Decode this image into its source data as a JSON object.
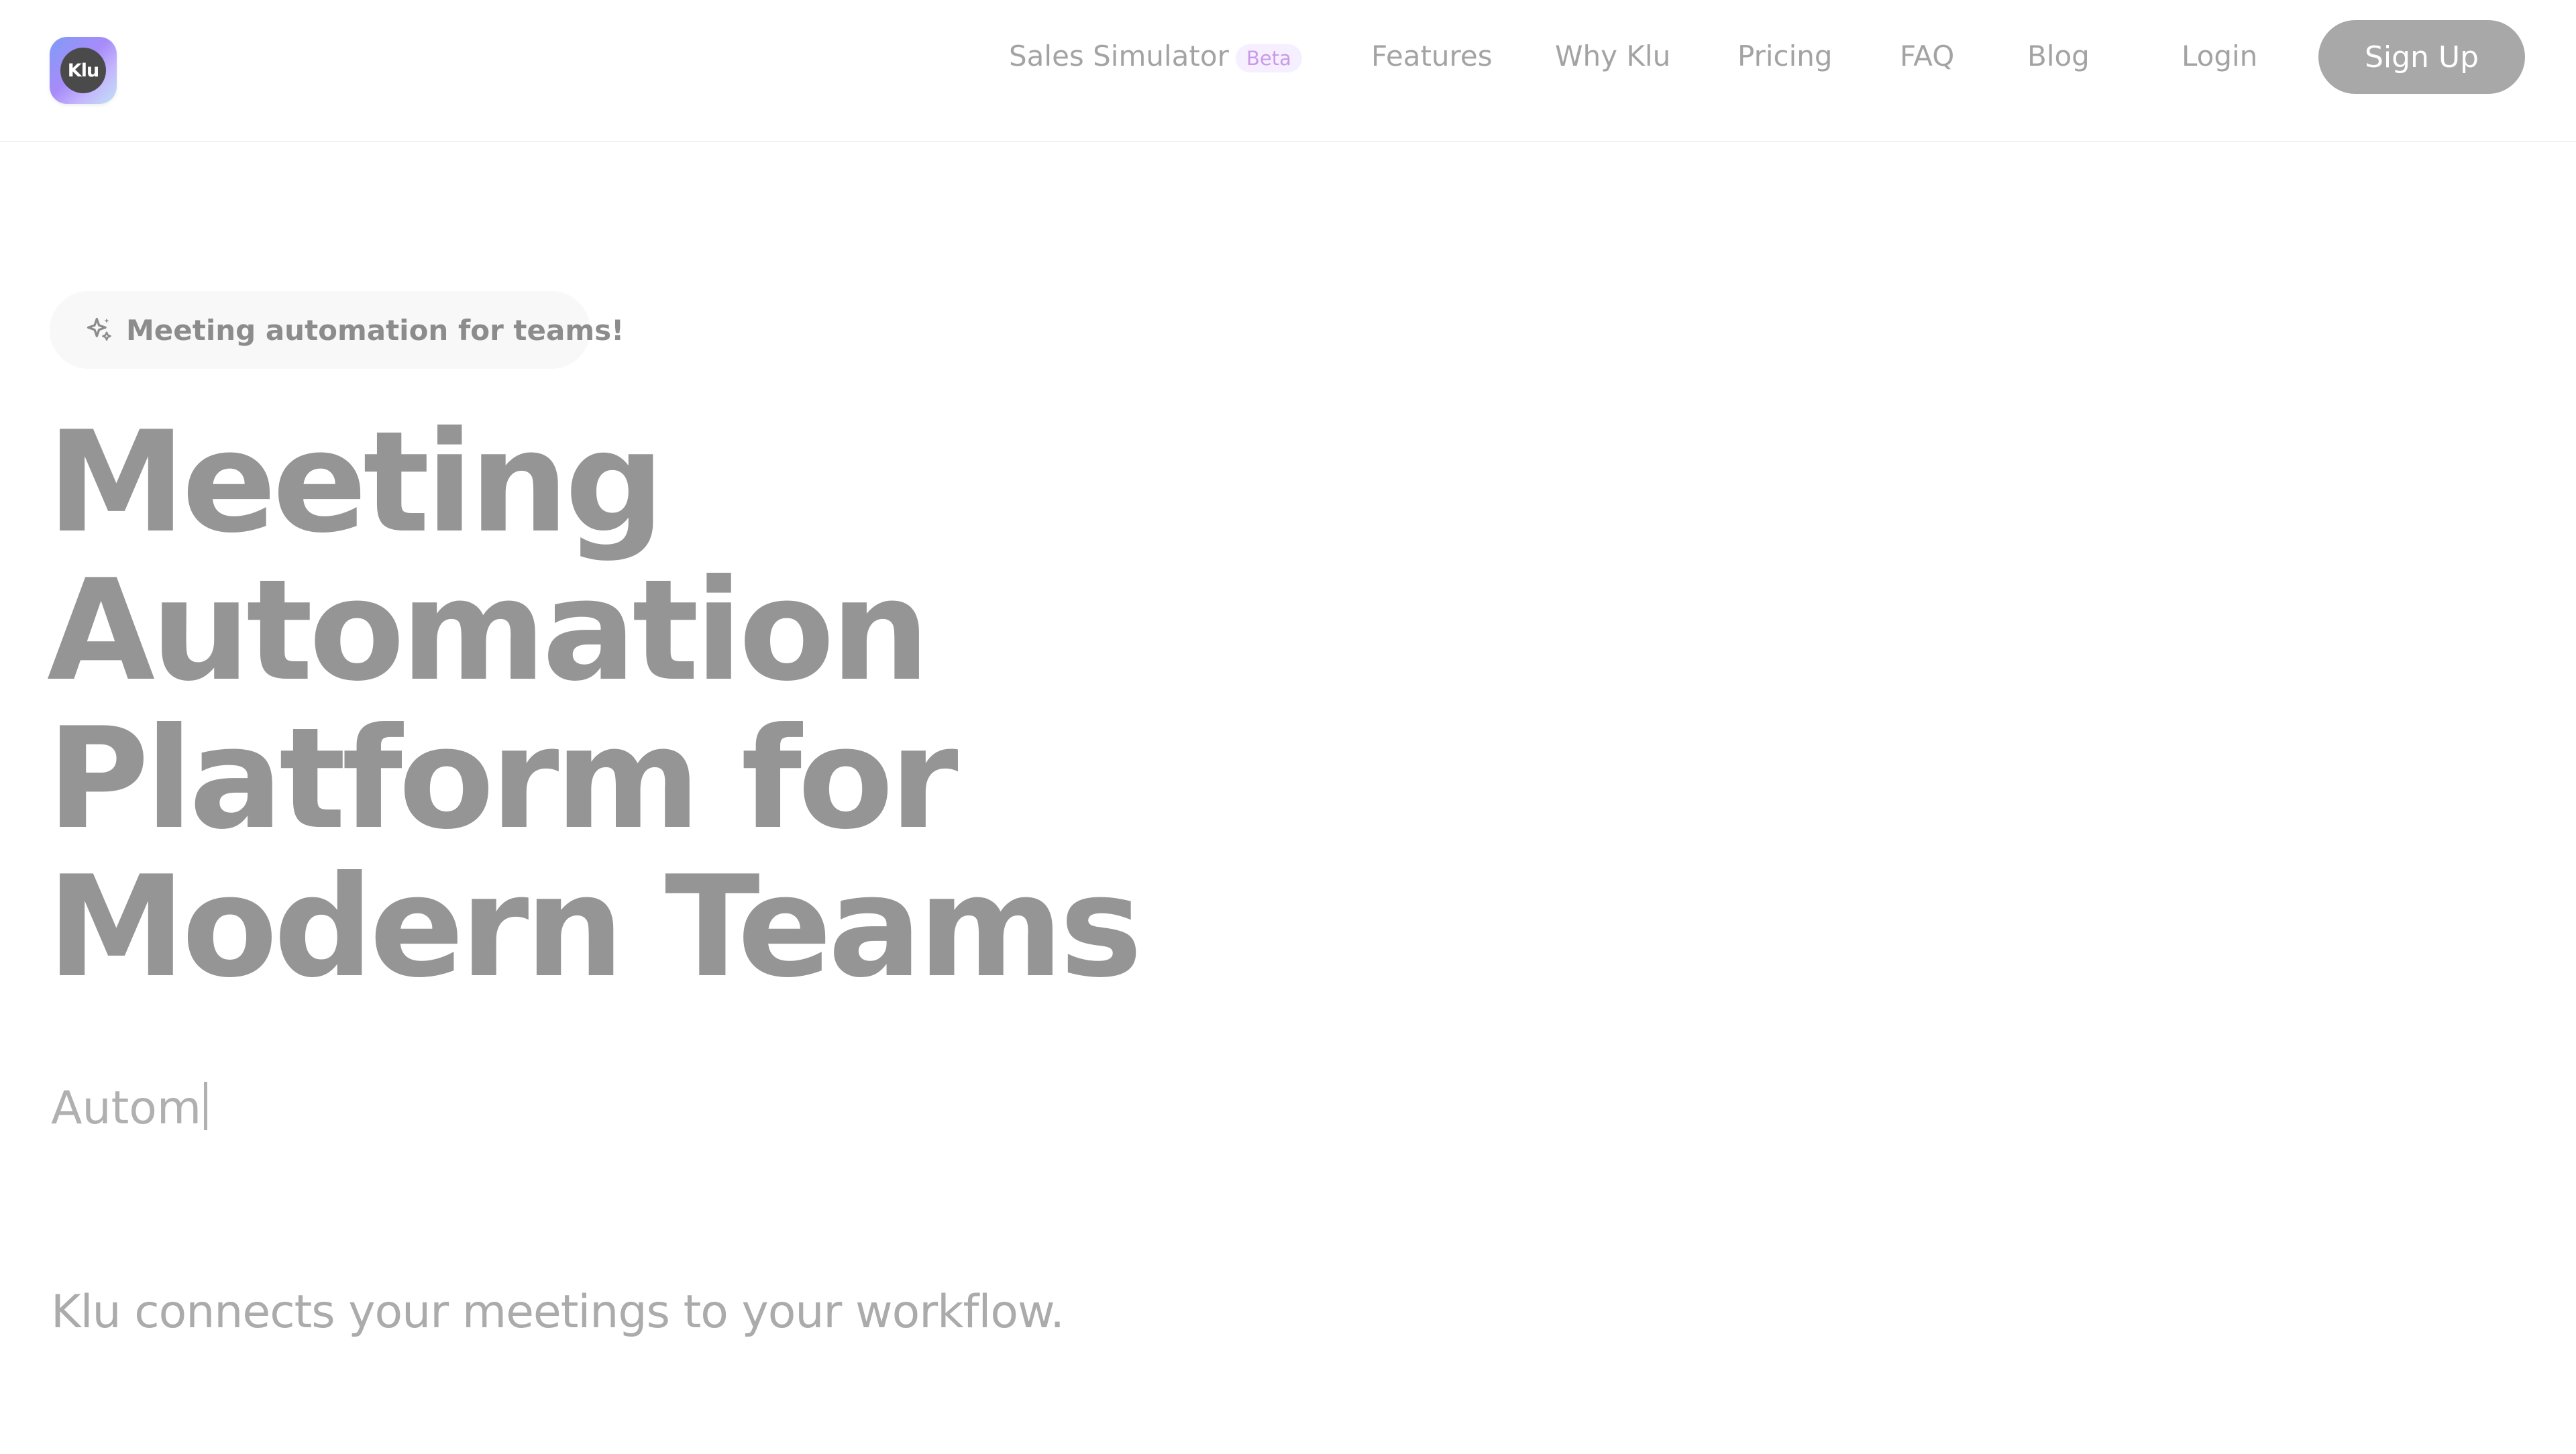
{
  "logo": {
    "text": "Klu"
  },
  "nav": {
    "sales_simulator": "Sales Simulator",
    "beta_badge": "Beta",
    "features": "Features",
    "why_klu": "Why Klu",
    "pricing": "Pricing",
    "faq": "FAQ",
    "blog": "Blog",
    "login": "Login",
    "sign_up": "Sign Up"
  },
  "hero": {
    "pill_icon": "sparkle-icon",
    "pill_text": "Meeting automation for teams!",
    "headline_lines": [
      "Meeting",
      "Automation",
      "Platform for",
      "Modern Teams"
    ],
    "typed_text": "Autom",
    "subline": "Klu connects your meetings to your workflow."
  },
  "colors": {
    "headline": "#959595",
    "nav_text": "#a3a3a3",
    "signup_bg": "#a8a8a8",
    "beta_bg": "#f6efff",
    "beta_text": "#c89ae8"
  }
}
